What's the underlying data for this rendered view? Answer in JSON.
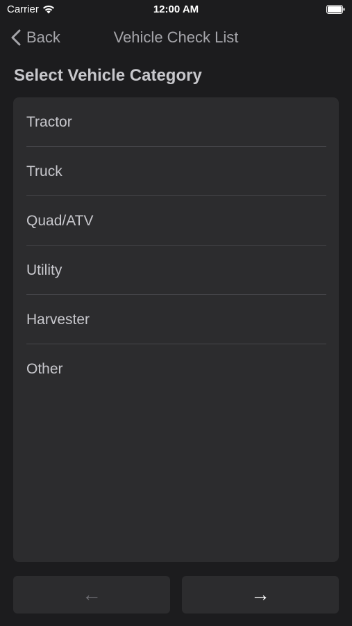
{
  "status_bar": {
    "carrier": "Carrier",
    "time": "12:00 AM"
  },
  "nav": {
    "back_label": "Back",
    "title": "Vehicle Check List"
  },
  "section_title": "Select Vehicle Category",
  "categories": [
    "Tractor",
    "Truck",
    "Quad/ATV",
    "Utility",
    "Harvester",
    "Other"
  ],
  "buttons": {
    "prev_icon": "←",
    "next_icon": "→"
  },
  "colors": {
    "background": "#1c1c1e",
    "card": "#2c2c2e",
    "text": "#c7c7cc",
    "disabled": "#6e6e73"
  }
}
